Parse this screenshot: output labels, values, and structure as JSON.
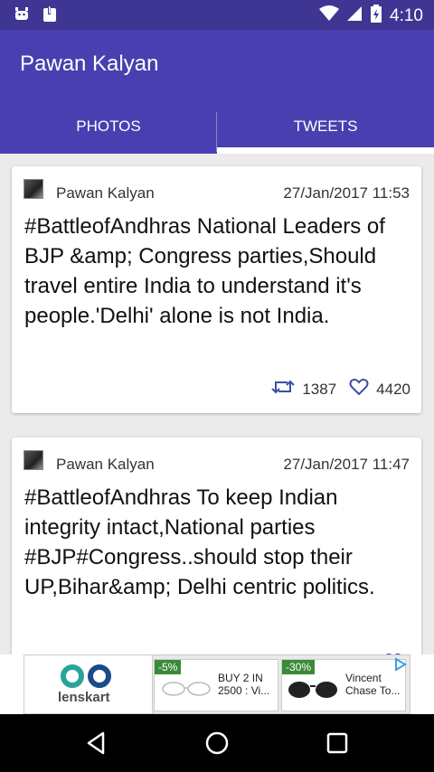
{
  "status_bar": {
    "time": "4:10",
    "icons": [
      "android-debug-icon",
      "notification-icon",
      "wifi-icon",
      "signal-icon",
      "battery-icon"
    ]
  },
  "app_bar": {
    "title": "Pawan Kalyan",
    "tabs": [
      {
        "label": "PHOTOS",
        "selected": false
      },
      {
        "label": "TWEETS",
        "selected": true
      }
    ]
  },
  "tweets": [
    {
      "author": "Pawan Kalyan",
      "date": "27/Jan/2017 11:53",
      "text": "#BattleofAndhras National Leaders of BJP &amp; Congress parties,Should travel entire India to understand it's people.'Delhi' alone is not India.",
      "retweets": "1387",
      "likes": "4420"
    },
    {
      "author": "Pawan Kalyan",
      "date": "27/Jan/2017 11:47",
      "text": "#BattleofAndhras To keep Indian integrity intact,National parties #BJP#Congress..should stop their UP,Bihar&amp; Delhi centric politics.",
      "retweets": "",
      "likes": ""
    }
  ],
  "ad": {
    "brand": "lenskart",
    "products": [
      {
        "discount": "-5%",
        "description": "BUY 2 IN 2500 : Vi..."
      },
      {
        "discount": "-30%",
        "description": "Vincent Chase To..."
      }
    ]
  },
  "colors": {
    "status_bar": "#3f3593",
    "app_bar": "#4a3fb0",
    "accent": "#3a4fa8"
  }
}
